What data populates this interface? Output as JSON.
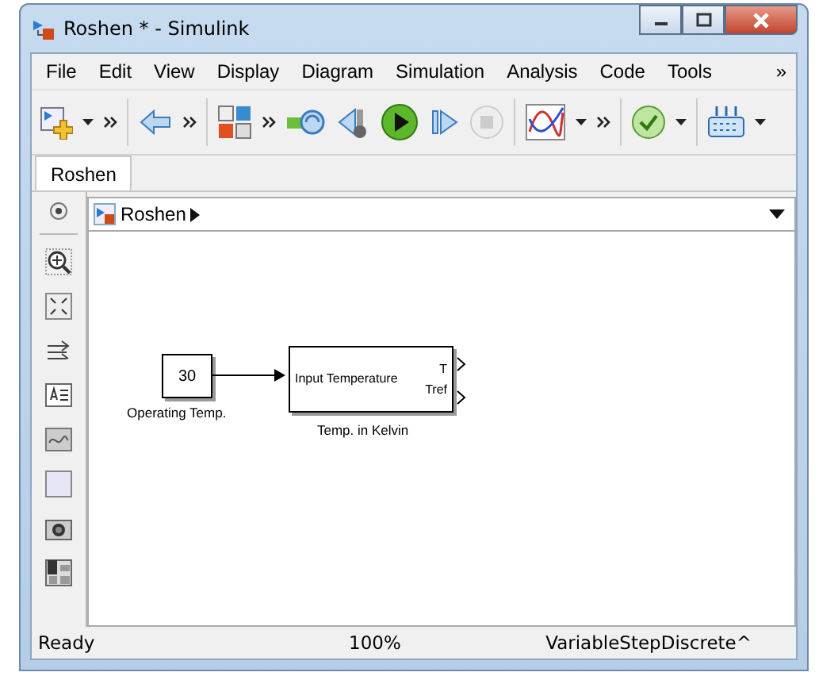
{
  "window": {
    "title": "Roshen * - Simulink"
  },
  "menu": {
    "items": [
      "File",
      "Edit",
      "View",
      "Display",
      "Diagram",
      "Simulation",
      "Analysis",
      "Code",
      "Tools"
    ],
    "overflow": "»"
  },
  "tabs": [
    {
      "label": "Roshen",
      "selected": true
    }
  ],
  "breadcrumb": {
    "path": "Roshen"
  },
  "blocks": [
    {
      "kind": "constant",
      "value": "30",
      "label": "Operating Temp."
    },
    {
      "kind": "subsystem",
      "inputs": [
        "Input Temperature"
      ],
      "outputs": [
        "T",
        "Tref"
      ],
      "label": "Temp. in Kelvin"
    }
  ],
  "status_bar": {
    "state": "Ready",
    "zoom": "100%",
    "solver": "VariableStepDiscrete^"
  }
}
